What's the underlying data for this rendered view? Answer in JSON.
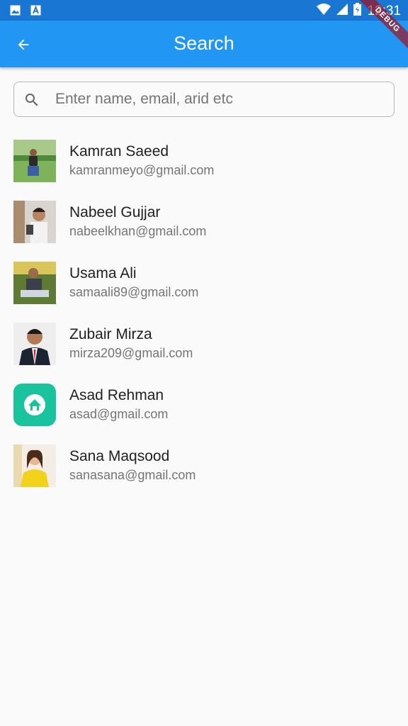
{
  "status_bar": {
    "time": "12:31",
    "icons": [
      "image-icon",
      "text-icon",
      "wifi-icon",
      "signal-icon",
      "battery-icon"
    ]
  },
  "app_bar": {
    "title": "Search",
    "back_icon": "arrow-back-icon",
    "color": "#2196f3",
    "debug_label": "DEBUG"
  },
  "search": {
    "placeholder": "Enter name, email, arid etc",
    "value": ""
  },
  "contacts": [
    {
      "name": "Kamran Saeed",
      "email": "kamranmeyo@gmail.com"
    },
    {
      "name": "Nabeel Gujjar",
      "email": "nabeelkhan@gmail.com"
    },
    {
      "name": "Usama Ali",
      "email": "samaali89@gmail.com"
    },
    {
      "name": "Zubair Mirza",
      "email": "mirza209@gmail.com"
    },
    {
      "name": "Asad Rehman",
      "email": "asad@gmail.com"
    },
    {
      "name": "Sana Maqsood",
      "email": "sanasana@gmail.com"
    }
  ]
}
